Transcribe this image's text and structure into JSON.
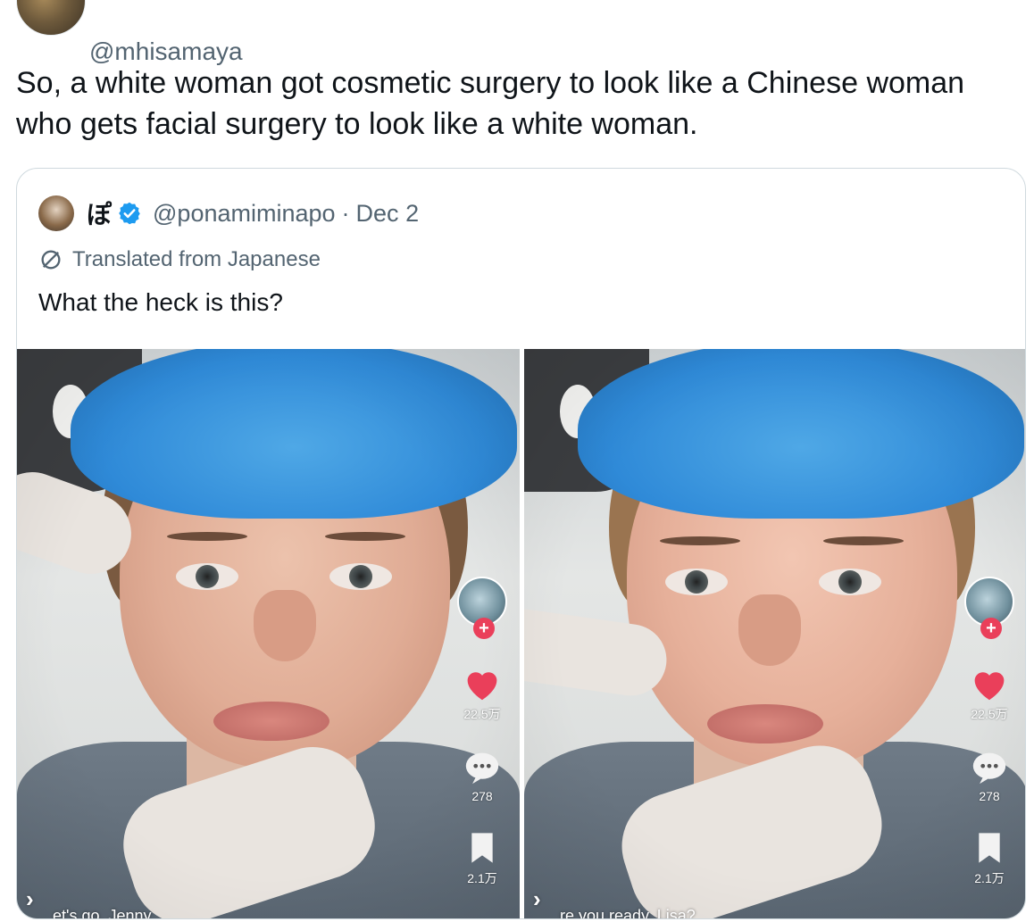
{
  "tweet": {
    "handle": "@mhisamaya",
    "text": "So, a white woman got cosmetic surgery to look like a Chinese woman who gets facial surgery to look like a white woman."
  },
  "quote": {
    "name": "ぽ",
    "handle": "@ponamiminapo",
    "separator": "·",
    "date": "Dec 2",
    "translated_label": "Translated from Japanese",
    "text": "What the heck is this?",
    "verified_color": "#1d9bf0"
  },
  "media": [
    {
      "likes": "22.5万",
      "comments": "278",
      "saves": "2.1万",
      "caption": "et's go, Jenny"
    },
    {
      "likes": "22.5万",
      "comments": "278",
      "saves": "2.1万",
      "caption": "re you ready, Lisa?"
    }
  ],
  "icons": {
    "verified": "verified-badge-icon",
    "translate": "translate-icon",
    "like": "heart-icon",
    "comment": "comment-icon",
    "save": "bookmark-icon",
    "follow": "plus-icon"
  },
  "colors": {
    "text": "#0f1419",
    "secondary": "#536471",
    "border": "#cfd9de",
    "heart": "#ea3f5a"
  }
}
